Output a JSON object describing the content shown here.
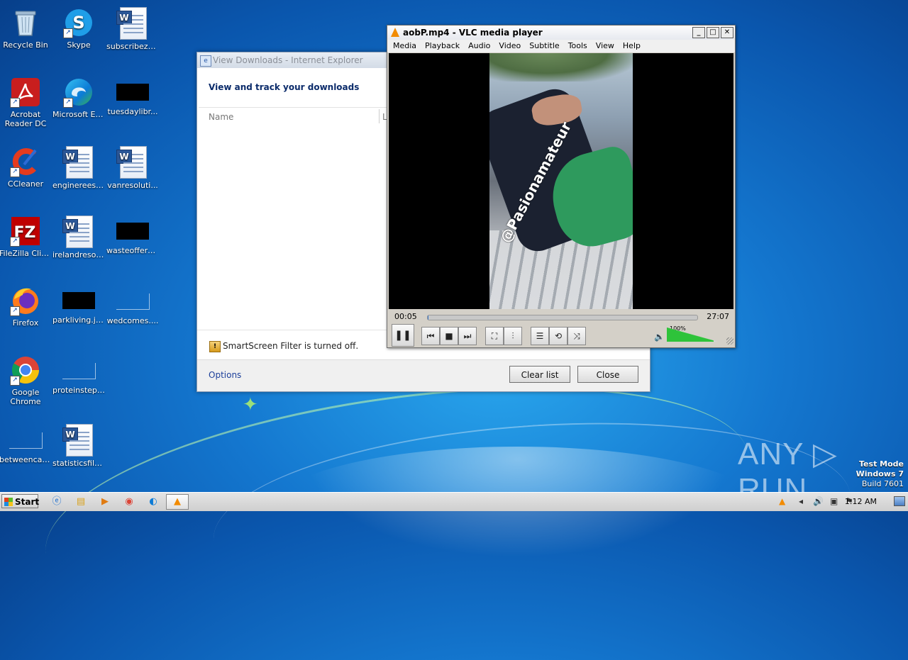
{
  "desktop": {
    "icons": [
      {
        "label": "Recycle Bin",
        "icon": "recycle-bin-icon"
      },
      {
        "label": "Skype",
        "icon": "skype-icon"
      },
      {
        "label": "subscribeze...",
        "icon": "word-doc-icon"
      },
      {
        "label": "Acrobat Reader DC",
        "icon": "acrobat-icon"
      },
      {
        "label": "Microsoft Edge",
        "icon": "edge-icon"
      },
      {
        "label": "tuesdaylibr...",
        "icon": "file-icon"
      },
      {
        "label": "CCleaner",
        "icon": "ccleaner-icon"
      },
      {
        "label": "enginereesp...",
        "icon": "word-doc-icon"
      },
      {
        "label": "vanresoluti...",
        "icon": "word-doc-icon"
      },
      {
        "label": "FileZilla Client",
        "icon": "filezilla-icon"
      },
      {
        "label": "irelandresor...",
        "icon": "word-doc-icon"
      },
      {
        "label": "wasteoffers...",
        "icon": "file-icon"
      },
      {
        "label": "Firefox",
        "icon": "firefox-icon"
      },
      {
        "label": "parkliving.jpg",
        "icon": "image-icon"
      },
      {
        "label": "wedcomes....",
        "icon": "file-icon"
      },
      {
        "label": "Google Chrome",
        "icon": "chrome-icon"
      },
      {
        "label": "proteinstep....",
        "icon": "file-icon"
      },
      {
        "label": "betweencab...",
        "icon": "file-icon"
      },
      {
        "label": "statisticsfile...",
        "icon": "word-doc-icon"
      }
    ]
  },
  "ie_window": {
    "title": "View Downloads - Internet Explorer",
    "heading": "View and track your downloads",
    "columns": {
      "name": "Name",
      "location": "L"
    },
    "smartscreen_text": "SmartScreen Filter is turned off.",
    "options_link": "Options",
    "clear_list_button": "Clear list",
    "close_button": "Close"
  },
  "vlc_window": {
    "title": "aobP.mp4 - VLC media player",
    "menu": [
      "Media",
      "Playback",
      "Audio",
      "Video",
      "Subtitle",
      "Tools",
      "View",
      "Help"
    ],
    "video_watermark": "@Pasionamateur",
    "current_time": "00:05",
    "total_time": "27:07",
    "progress": 0.003,
    "volume_label": "100%",
    "volume": 1.0
  },
  "watermark": {
    "brand": "ANY ▷ RUN",
    "test_mode": "Test Mode",
    "os": "Windows 7",
    "build": "Build 7601"
  },
  "taskbar": {
    "start_label": "Start",
    "clock": "1:12 AM"
  },
  "colors": {
    "accent": "#1c3f9a",
    "vlc_orange": "#f28b00",
    "volume_green": "#2ec33a"
  }
}
